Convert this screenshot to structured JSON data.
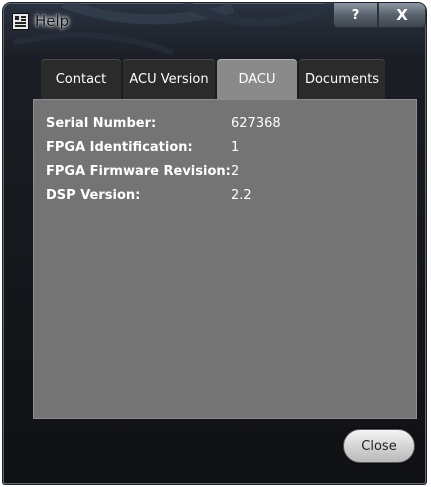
{
  "window": {
    "title": "Help",
    "help_button_label": "?",
    "close_button_label": "X"
  },
  "tabs": [
    {
      "label": "Contact",
      "active": false
    },
    {
      "label": "ACU Version",
      "active": false
    },
    {
      "label": "DACU",
      "active": true
    },
    {
      "label": "Documents",
      "active": false
    }
  ],
  "dacu": {
    "rows": [
      {
        "label": "Serial Number:",
        "value": "627368"
      },
      {
        "label": "FPGA Identification:",
        "value": "1"
      },
      {
        "label": "FPGA Firmware Revision:",
        "value": "2"
      },
      {
        "label": "DSP Version:",
        "value": "2.2"
      }
    ]
  },
  "footer": {
    "close_label": "Close"
  },
  "colors": {
    "panel": "#747474",
    "active_tab": "#8a8a8a",
    "inactive_tab": "#2b2b2b",
    "frame": "#101114"
  },
  "icons": {
    "app": "acu-app-icon"
  }
}
